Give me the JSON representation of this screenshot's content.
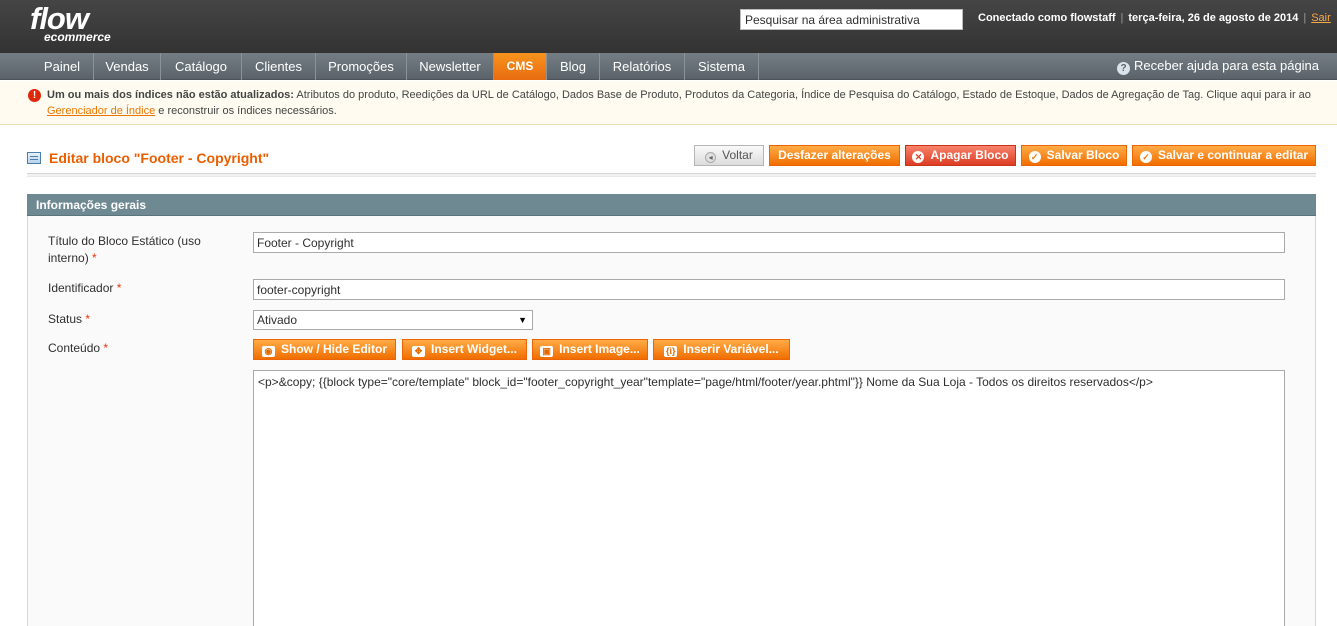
{
  "header": {
    "logo_main": "flow",
    "logo_sub": "ecommerce",
    "search_value": "Pesquisar na área administrativa",
    "logged_in_prefix": "Conectado como ",
    "username": "flowstaff",
    "date": "terça-feira, 26 de agosto de 2014",
    "logout": "Sair"
  },
  "nav": {
    "items": [
      {
        "label": "Painel"
      },
      {
        "label": "Vendas"
      },
      {
        "label": "Catálogo"
      },
      {
        "label": "Clientes"
      },
      {
        "label": "Promoções"
      },
      {
        "label": "Newsletter"
      },
      {
        "label": "CMS",
        "active": true
      },
      {
        "label": "Blog"
      },
      {
        "label": "Relatórios"
      },
      {
        "label": "Sistema"
      }
    ],
    "help": "Receber ajuda para esta página"
  },
  "notice": {
    "bold": "Um ou mais dos índices não estão atualizados:",
    "text": " Atributos do produto, Reedições da URL de Catálogo, Dados Base de Produto, Produtos da Categoria, Índice de Pesquisa do Catálogo, Estado de Estoque, Dados de Agregação de Tag. Clique aqui para ir ao",
    "link": "Gerenciador de Índice",
    "text_after": " e reconstruir os índices necessários."
  },
  "page": {
    "title": "Editar bloco \"Footer - Copyright\"",
    "buttons": {
      "back": "Voltar",
      "reset": "Desfazer alterações",
      "delete": "Apagar Bloco",
      "save": "Salvar Bloco",
      "save_continue": "Salvar e continuar a editar"
    }
  },
  "form": {
    "section_title": "Informações gerais",
    "title_label_line1": "Título do Bloco Estático (uso",
    "title_label_line2": "interno)",
    "title_value": "Footer - Copyright",
    "identifier_label": "Identificador",
    "identifier_value": "footer-copyright",
    "status_label": "Status",
    "status_value": "Ativado",
    "content_label": "Conteúdo",
    "required_mark": "*",
    "editor_buttons": {
      "toggle": "Show / Hide Editor",
      "widget": "Insert Widget...",
      "image": "Insert Image...",
      "variable": "Inserir Variável..."
    },
    "content_value": "<p>&copy; {{block type=\"core/template\" block_id=\"footer_copyright_year\"template=\"page/html/footer/year.phtml\"}} Nome da Sua Loja - Todos os direitos reservados</p>"
  }
}
